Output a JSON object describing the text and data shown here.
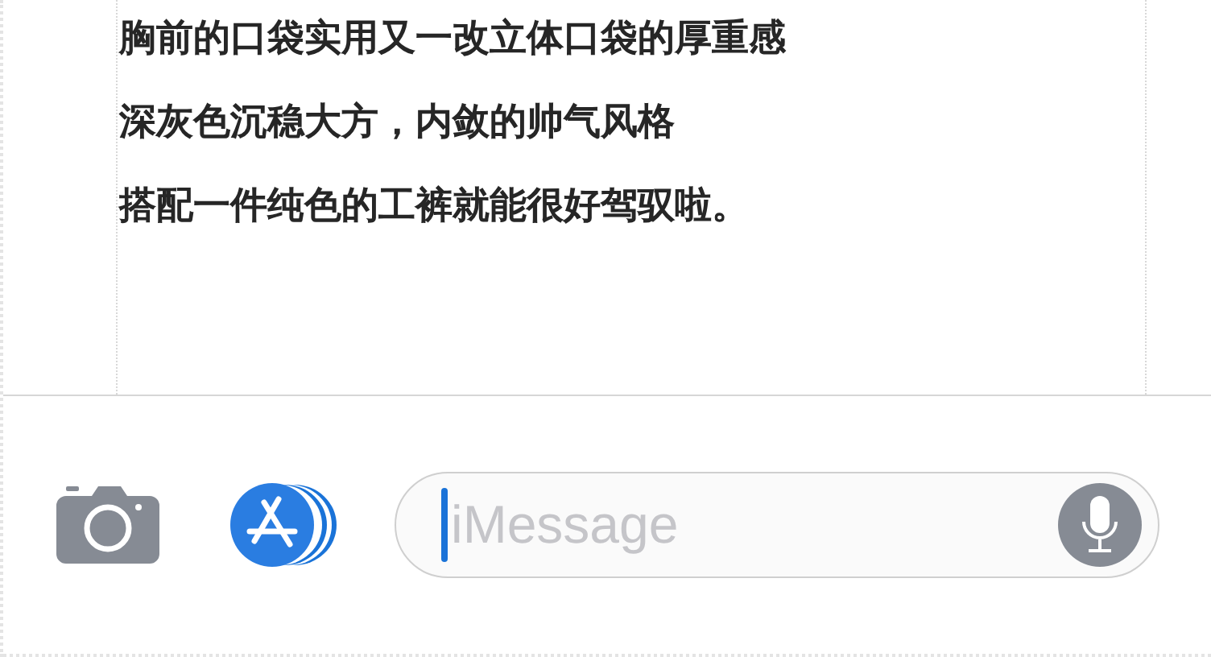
{
  "message_lines": [
    "胸前的口袋实用又一改立体口袋的厚重感",
    "深灰色沉稳大方，内敛的帅气风格",
    "搭配一件纯色的工裤就能很好驾驭啦。"
  ],
  "input_bar": {
    "placeholder": "iMessage"
  }
}
